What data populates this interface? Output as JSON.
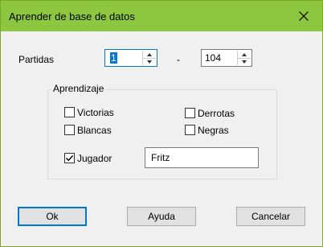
{
  "dialog": {
    "title": "Aprender de base de datos"
  },
  "partidas": {
    "label": "Partidas",
    "from": "1",
    "separator": "-",
    "to": "104"
  },
  "aprendizaje": {
    "legend": "Aprendizaje",
    "victorias": {
      "label": "Victorias",
      "checked": false
    },
    "derrotas": {
      "label": "Derrotas",
      "checked": false
    },
    "blancas": {
      "label": "Blancas",
      "checked": false
    },
    "negras": {
      "label": "Negras",
      "checked": false
    },
    "jugador": {
      "label": "Jugador",
      "checked": true,
      "value": "Fritz"
    }
  },
  "buttons": {
    "ok": "Ok",
    "ayuda": "Ayuda",
    "cancelar": "Cancelar"
  },
  "colors": {
    "titlebar": "#8dc63f",
    "focus": "#0078d7",
    "dialog_bg": "#f0f0f0"
  }
}
